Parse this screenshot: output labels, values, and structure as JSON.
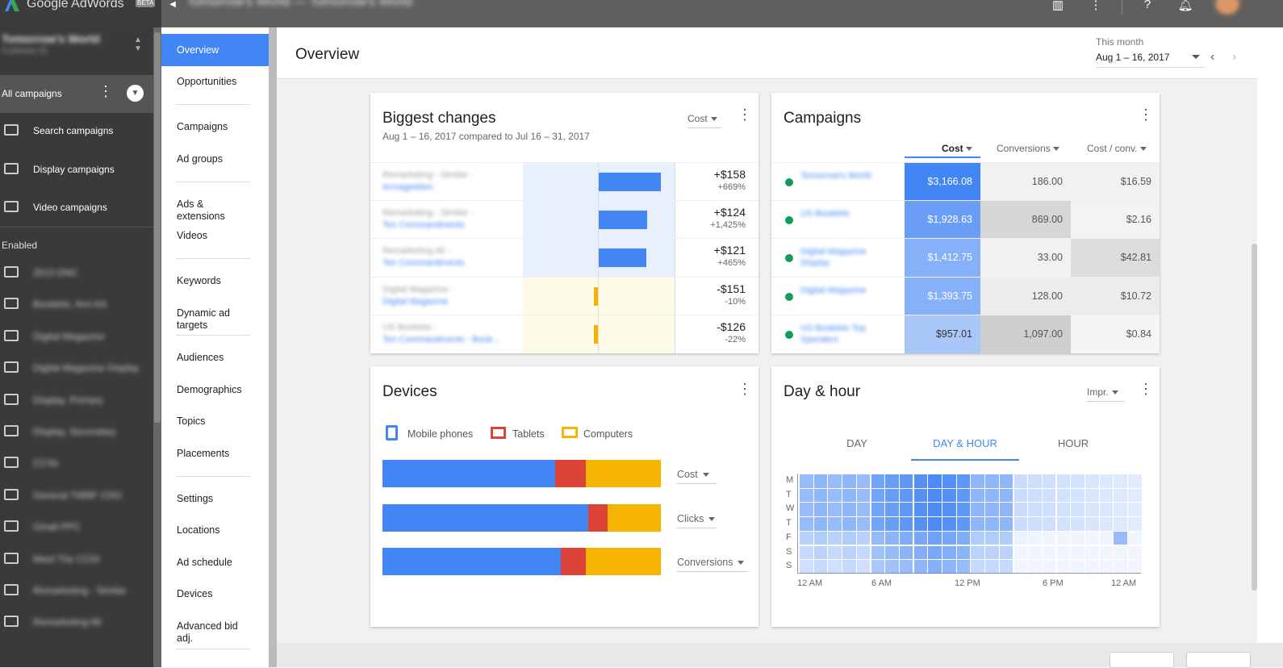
{
  "app": {
    "logo_text": "Google AdWords",
    "beta": "BETA",
    "account_title": "Tomorrow's World — Tomorrow's World"
  },
  "sidebar": {
    "account_name": "Tomorrow's World",
    "account_sub": "Customer ID",
    "all_campaigns": "All campaigns",
    "types": [
      {
        "label": "Search campaigns",
        "icon": "search-icon"
      },
      {
        "label": "Display campaigns",
        "icon": "display-icon"
      },
      {
        "label": "Video campaigns",
        "icon": "video-icon"
      }
    ],
    "enabled_label": "Enabled",
    "campaigns": [
      {
        "label": "2013 DNC",
        "icon": "search-icon"
      },
      {
        "label": "Booklets, Ann Kit",
        "icon": "search-icon"
      },
      {
        "label": "Digital Magazine",
        "icon": "search-icon"
      },
      {
        "label": "Digital Magazine Display",
        "icon": "display-icon"
      },
      {
        "label": "Display, Primary",
        "icon": "display-icon"
      },
      {
        "label": "Display, Secondary",
        "icon": "display-icon"
      },
      {
        "label": "CCVe",
        "icon": "search-icon"
      },
      {
        "label": "General TWBF CDO",
        "icon": "search-icon"
      },
      {
        "label": "Gmail PPC",
        "icon": "display-icon"
      },
      {
        "label": "Meet The CCDi",
        "icon": "display-icon"
      },
      {
        "label": "Remarketing - Similar",
        "icon": "display-icon"
      },
      {
        "label": "Remarketing All",
        "icon": "display-icon"
      }
    ]
  },
  "subnav": {
    "items": [
      {
        "label": "Overview",
        "active": true
      },
      {
        "label": "Opportunities"
      },
      {
        "label": "Campaigns"
      },
      {
        "label": "Ad groups"
      },
      {
        "label": "Ads & extensions"
      },
      {
        "label": "Videos"
      },
      {
        "label": "Keywords"
      },
      {
        "label": "Dynamic ad targets"
      },
      {
        "label": "Audiences"
      },
      {
        "label": "Demographics"
      },
      {
        "label": "Topics"
      },
      {
        "label": "Placements"
      },
      {
        "label": "Settings"
      },
      {
        "label": "Locations"
      },
      {
        "label": "Ad schedule"
      },
      {
        "label": "Devices"
      },
      {
        "label": "Advanced bid adj."
      }
    ]
  },
  "header": {
    "title": "Overview",
    "range_label": "This month",
    "range_value": "Aug 1 – 16, 2017"
  },
  "biggest_changes": {
    "title": "Biggest changes",
    "subtitle": "Aug 1 – 16, 2017 compared to Jul 16 – 31, 2017",
    "metric": "Cost",
    "rows": [
      {
        "l1": "Remarketing - Similar -",
        "l2": "Armageddon",
        "value": "+$158",
        "pct": "+669%",
        "bar": 158,
        "positive": true
      },
      {
        "l1": "Remarketing - Similar -",
        "l2": "Ten Commandments",
        "value": "+$124",
        "pct": "+1,425%",
        "bar": 124,
        "positive": true
      },
      {
        "l1": "Remarketing All -",
        "l2": "Ten Commandments",
        "value": "+$121",
        "pct": "+465%",
        "bar": 121,
        "positive": true
      },
      {
        "l1": "Digital Magazine -",
        "l2": "Digital Magazine",
        "value": "-$151",
        "pct": "-10%",
        "bar": 151,
        "positive": false
      },
      {
        "l1": "US Booklets -",
        "l2": "Ten Commandments - Book...",
        "value": "-$126",
        "pct": "-22%",
        "bar": 126,
        "positive": false
      }
    ]
  },
  "campaigns_card": {
    "title": "Campaigns",
    "headers": [
      "Cost",
      "Conversions",
      "Cost / conv."
    ],
    "rows": [
      {
        "name": "Tomorrow's World",
        "cost": "$3,166.08",
        "conv": "186.00",
        "cpc": "$16.59"
      },
      {
        "name": "US Booklets",
        "cost": "$1,928.63",
        "conv": "869.00",
        "cpc": "$2.16"
      },
      {
        "name": "Digital Magazine Display",
        "cost": "$1,412.75",
        "conv": "33.00",
        "cpc": "$42.81"
      },
      {
        "name": "Digital Magazine",
        "cost": "$1,393.75",
        "conv": "128.00",
        "cpc": "$10.72"
      },
      {
        "name": "US Booklets Top Spenders",
        "cost": "$957.01",
        "conv": "1,097.00",
        "cpc": "$0.84"
      }
    ],
    "cost_colors": [
      "#4285f4",
      "#6a9ef6",
      "#86b0f7",
      "#86b0f7",
      "#a9c6f9"
    ],
    "conv_colors": [
      "#f1f1f1",
      "#d6d6d6",
      "#f1f1f1",
      "#ececec",
      "#cfcfcf"
    ],
    "cpc_colors": [
      "#f1f1f1",
      "#f3f3f3",
      "#dcdcdc",
      "#ececec",
      "#f5f5f5"
    ]
  },
  "devices": {
    "title": "Devices",
    "legend": [
      {
        "label": "Mobile phones",
        "color": "#4285f4"
      },
      {
        "label": "Tablets",
        "color": "#db4437"
      },
      {
        "label": "Computers",
        "color": "#f4b400"
      }
    ],
    "metrics": [
      {
        "label": "Cost",
        "mobile": 0.62,
        "tablet": 0.11,
        "computer": 0.27
      },
      {
        "label": "Clicks",
        "mobile": 0.74,
        "tablet": 0.07,
        "computer": 0.19
      },
      {
        "label": "Conversions",
        "mobile": 0.64,
        "tablet": 0.09,
        "computer": 0.27
      }
    ]
  },
  "day_hour": {
    "title": "Day & hour",
    "metric": "Impr.",
    "tabs": [
      "DAY",
      "DAY & HOUR",
      "HOUR"
    ],
    "active_tab": 1,
    "days": [
      "M",
      "T",
      "W",
      "T",
      "F",
      "S",
      "S"
    ],
    "hour_labels": [
      "12 AM",
      "6 AM",
      "12 PM",
      "6 PM",
      "12 AM"
    ]
  },
  "colors": {
    "accent": "#4285f4",
    "green": "#0f9d58",
    "positive_bar": "#4285f4",
    "negative_bar": "#f4b400"
  }
}
